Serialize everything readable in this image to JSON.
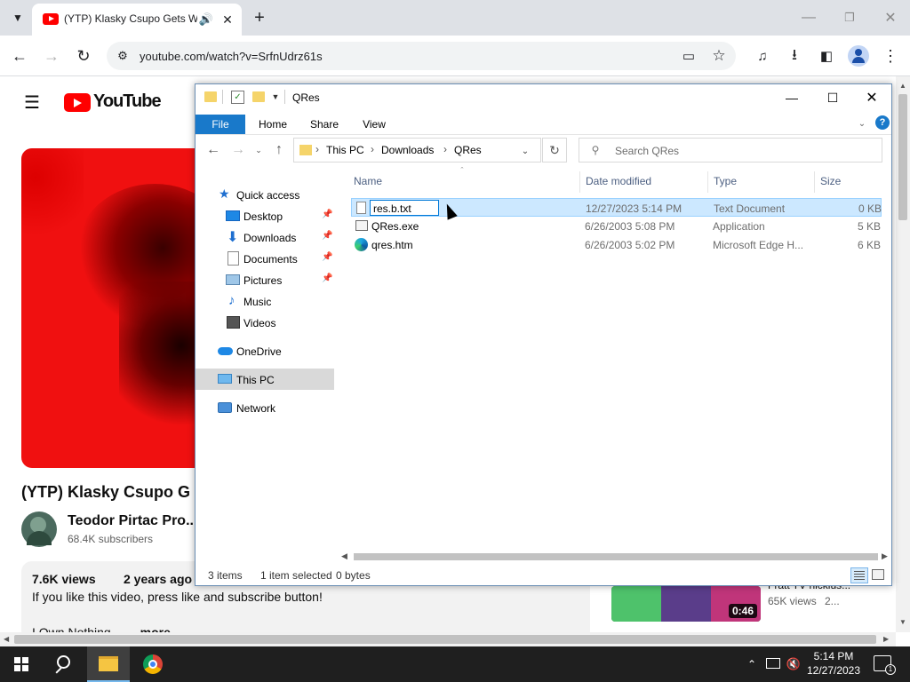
{
  "browser": {
    "tab_title": "(YTP) Klasky Csupo Gets We",
    "url": "youtube.com/watch?v=SrfnUdrz61s"
  },
  "youtube": {
    "logo_text": "YouTube",
    "video_title": "(YTP) Klasky Csupo G",
    "channel_name": "Teodor Pirtac Pro...",
    "subscribers": "68.4K subscribers",
    "views": "7.6K views",
    "age": "2 years ago",
    "description": "If you like this video, press like and subscribe button!",
    "description_line2": "I Own Nothing",
    "more_label": "...more",
    "side_views": "65K views",
    "side_age": "2...",
    "side_title": "Fratt TV nicklus...",
    "side_duration": "0:46"
  },
  "explorer": {
    "title": "QRes",
    "ribbon_tabs": [
      "File",
      "Home",
      "Share",
      "View"
    ],
    "breadcrumb": [
      "This PC",
      "Downloads",
      "QRes"
    ],
    "search_placeholder": "Search QRes",
    "sidebar": [
      {
        "label": "Quick access",
        "icon": "star-icon",
        "pinned": false
      },
      {
        "label": "Desktop",
        "icon": "desktop-icon",
        "pinned": true
      },
      {
        "label": "Downloads",
        "icon": "download-icon",
        "pinned": true
      },
      {
        "label": "Documents",
        "icon": "documents-icon",
        "pinned": true
      },
      {
        "label": "Pictures",
        "icon": "pictures-icon",
        "pinned": true
      },
      {
        "label": "Music",
        "icon": "music-icon",
        "pinned": false
      },
      {
        "label": "Videos",
        "icon": "videos-icon",
        "pinned": false
      },
      {
        "label": "OneDrive",
        "icon": "cloud-icon",
        "pinned": false
      },
      {
        "label": "This PC",
        "icon": "computer-icon",
        "pinned": false
      },
      {
        "label": "Network",
        "icon": "network-icon",
        "pinned": false
      }
    ],
    "columns": [
      "Name",
      "Date modified",
      "Type",
      "Size"
    ],
    "files": [
      {
        "name": "res.b.txt",
        "date": "12/27/2023 5:14 PM",
        "type": "Text Document",
        "size": "0 KB"
      },
      {
        "name": "QRes.exe",
        "date": "6/26/2003 5:08 PM",
        "type": "Application",
        "size": "5 KB"
      },
      {
        "name": "qres.htm",
        "date": "6/26/2003 5:02 PM",
        "type": "Microsoft Edge H...",
        "size": "6 KB"
      }
    ],
    "status_items": "3 items",
    "status_selected": "1 item selected",
    "status_size": "0 bytes"
  },
  "taskbar": {
    "time": "5:14 PM",
    "date": "12/27/2023",
    "notification_count": "1"
  },
  "colors": {
    "accent": "#0078d7",
    "selection": "#cce8ff",
    "youtube_red": "#ff0000"
  }
}
